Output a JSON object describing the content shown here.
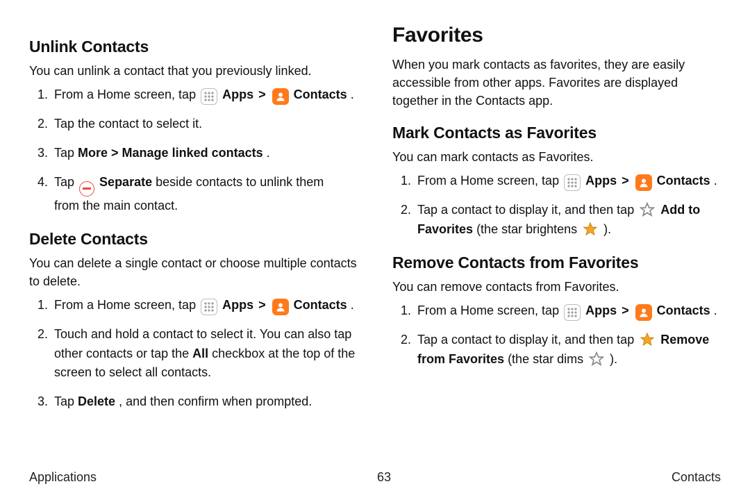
{
  "left": {
    "h2a": "Unlink Contacts",
    "p1": "You can unlink a contact that you previously linked.",
    "li1_a": "From a Home screen, tap ",
    "li1_apps": "Apps",
    "li1_contacts": "Contacts",
    "li1_period": " .",
    "li2": "Tap the contact to select it.",
    "li3_a": "Tap ",
    "li3_b": "More > Manage linked contacts",
    "li3_c": ".",
    "li4_a": "Tap ",
    "li4_sep": "Separate",
    "li4_b": "  beside contacts to unlink them from the main contact.",
    "h2b": "Delete Contacts",
    "p2": "You can delete a single contact or choose multiple contacts to delete.",
    "d_li1_a": "From a Home screen, tap ",
    "d_li1_apps": "Apps",
    "d_li1_contacts": "Contacts",
    "d_li1_period": ".",
    "d_li2_a": "Touch and hold a contact to select it. You can also tap other contacts or tap the ",
    "d_li2_all": "All",
    "d_li2_b": " checkbox at the top of the screen to select all contacts.",
    "d_li3_a": "Tap ",
    "d_li3_delete": "Delete",
    "d_li3_b": ", and then confirm when prompted."
  },
  "right": {
    "h1": "Favorites",
    "p1": "When you mark contacts as favorites, they are easily accessible from other apps. Favorites are displayed together in the Contacts app.",
    "h2a": "Mark Contacts as Favorites",
    "p2": "You can mark contacts as Favorites.",
    "m_li1_a": "From a Home screen, tap ",
    "m_li1_apps": "Apps",
    "m_li1_contacts": "Contacts",
    "m_li1_period": ".",
    "m_li2_a": "Tap a contact to display it, and then tap ",
    "m_li2_add": "Add to Favorites",
    "m_li2_b": " (the star brightens ",
    "m_li2_c": ").",
    "h2b": "Remove Contacts from Favorites",
    "p3": "You can remove contacts from Favorites.",
    "r_li1_a": "From a Home screen, tap ",
    "r_li1_apps": "Apps",
    "r_li1_contacts": "Contacts",
    "r_li1_period": ".",
    "r_li2_a": "Tap a contact to display it, and then tap ",
    "r_li2_remove": "Remove from Favorites",
    "r_li2_b": " (the star dims ",
    "r_li2_c": ")."
  },
  "footer": {
    "left": "Applications",
    "center": "63",
    "right": "Contacts"
  },
  "glyphs": {
    "rangle": ">"
  }
}
